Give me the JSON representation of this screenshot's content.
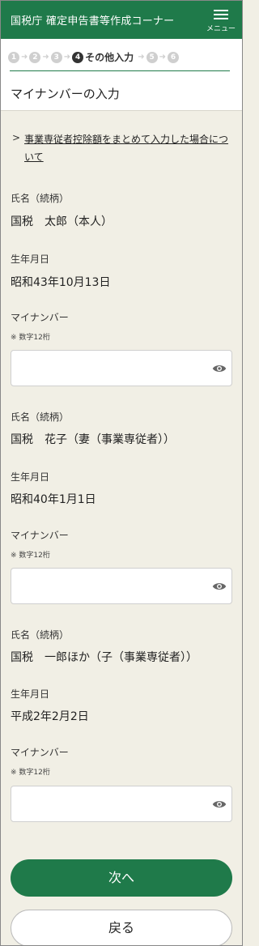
{
  "header": {
    "title": "国税庁 確定申告書等作成コーナー",
    "menu_label": "メニュー"
  },
  "steps": {
    "items": [
      "1",
      "2",
      "3",
      "4",
      "5",
      "6"
    ],
    "current_label": "その他入力"
  },
  "page_title": "マイナンバーの入力",
  "info_link": "事業専従者控除額をまとめて入力した場合について",
  "people": [
    {
      "name_label": "氏名（続柄）",
      "name_value": "国税　太郎（本人）",
      "birth_label": "生年月日",
      "birth_value": "昭和43年10月13日",
      "mynumber_label": "マイナンバー",
      "mynumber_hint": "※ 数字12桁",
      "mynumber_value": ""
    },
    {
      "name_label": "氏名（続柄）",
      "name_value": "国税　花子（妻（事業専従者））",
      "birth_label": "生年月日",
      "birth_value": "昭和40年1月1日",
      "mynumber_label": "マイナンバー",
      "mynumber_hint": "※ 数字12桁",
      "mynumber_value": ""
    },
    {
      "name_label": "氏名（続柄）",
      "name_value": "国税　一郎ほか（子（事業専従者））",
      "birth_label": "生年月日",
      "birth_value": "平成2年2月2日",
      "mynumber_label": "マイナンバー",
      "mynumber_hint": "※ 数字12桁",
      "mynumber_value": ""
    }
  ],
  "buttons": {
    "next": "次へ",
    "back": "戻る"
  },
  "colors": {
    "brand_green": "#1f7a4a",
    "background": "#f1efe5"
  }
}
